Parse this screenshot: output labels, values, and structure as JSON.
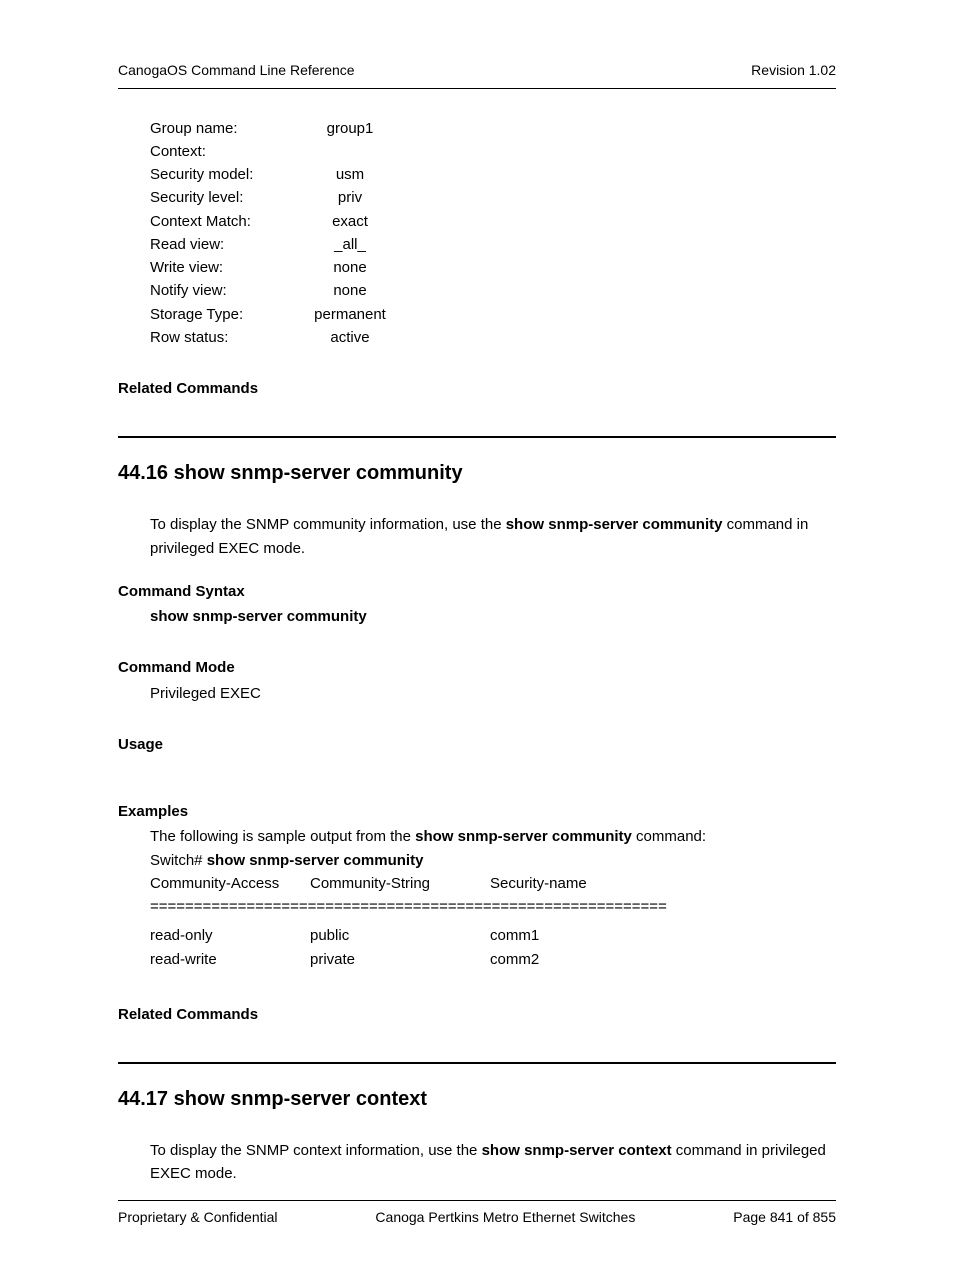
{
  "header": {
    "left": "CanogaOS Command Line Reference",
    "right": "Revision 1.02"
  },
  "group_info": {
    "rows": [
      {
        "label": "Group name:",
        "value": "group1"
      },
      {
        "label": "Context:",
        "value": ""
      },
      {
        "label": "Security model:",
        "value": "usm"
      },
      {
        "label": "Security level:",
        "value": "priv"
      },
      {
        "label": "Context Match:",
        "value": "exact"
      },
      {
        "label": "Read view:",
        "value": "_all_"
      },
      {
        "label": "Write view:",
        "value": "none"
      },
      {
        "label": "Notify view:",
        "value": "none"
      },
      {
        "label": "Storage Type:",
        "value": "permanent"
      },
      {
        "label": "Row status:",
        "value": "active"
      }
    ]
  },
  "related_commands_label": "Related Commands",
  "section16": {
    "title": "44.16  show snmp-server community",
    "intro_pre": "To display the SNMP community information, use the ",
    "intro_bold": "show snmp-server community",
    "intro_post": " command in privileged EXEC mode.",
    "syntax_label": "Command Syntax",
    "syntax_text": "show snmp-server community",
    "mode_label": "Command Mode",
    "mode_text": "Privileged EXEC",
    "usage_label": "Usage",
    "examples_label": "Examples",
    "examples_intro_pre": "The following is sample output from the ",
    "examples_intro_bold": "show snmp-server community",
    "examples_intro_post": " command:",
    "prompt_pre": "Switch# ",
    "prompt_bold": "show snmp-server community",
    "table": {
      "headers": {
        "a": "Community-Access",
        "b": "Community-String",
        "c": "Security-name"
      },
      "divider": "===========================================================",
      "rows": [
        {
          "a": "read-only",
          "b": "public",
          "c": "comm1"
        },
        {
          "a": "read-write",
          "b": "private",
          "c": "comm2"
        }
      ]
    }
  },
  "section17": {
    "title": "44.17  show snmp-server context",
    "intro_pre": "To display the SNMP context information, use the ",
    "intro_bold": "show snmp-server context",
    "intro_post": " command in privileged EXEC mode."
  },
  "footer": {
    "left": "Proprietary & Confidential",
    "center": "Canoga Pertkins Metro Ethernet Switches",
    "right": "Page 841 of 855"
  }
}
